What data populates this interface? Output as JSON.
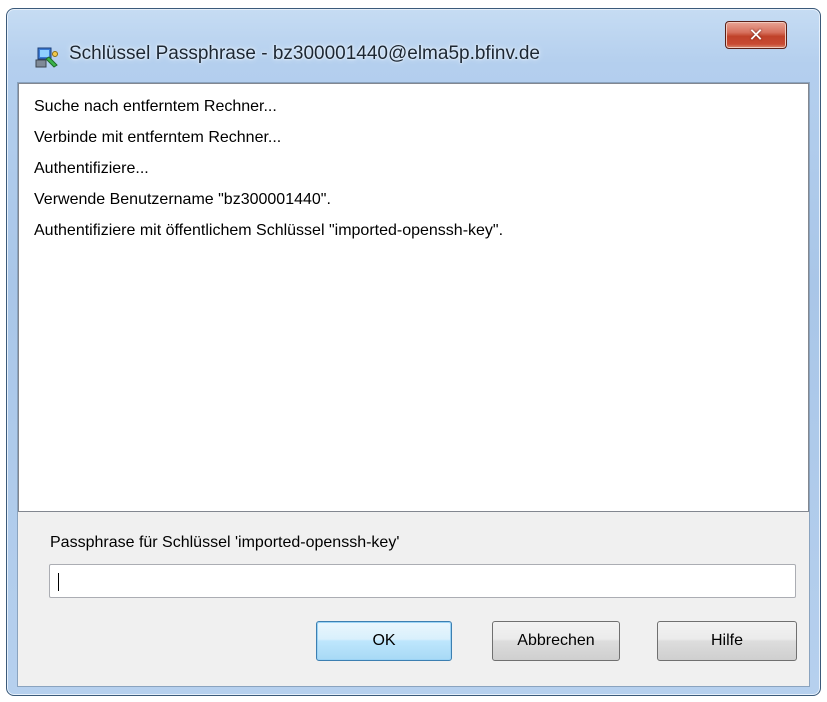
{
  "window": {
    "title": "Schlüssel Passphrase - bz300001440@elma5p.bfinv.de",
    "close_glyph": "✕",
    "icon": "putty-key-icon"
  },
  "log": {
    "lines": [
      "Suche nach entferntem Rechner...",
      "Verbinde mit entferntem Rechner...",
      "Authentifiziere...",
      "Verwende Benutzername \"bz300001440\".",
      "Authentifiziere mit öffentlichem Schlüssel \"imported-openssh-key\"."
    ]
  },
  "passphrase": {
    "label": "Passphrase für Schlüssel 'imported-openssh-key'",
    "value": ""
  },
  "buttons": {
    "ok": "OK",
    "cancel": "Abbrechen",
    "help": "Hilfe"
  },
  "colors": {
    "close_button": "#c8452d",
    "default_button_border": "#3c7fb1",
    "frame": "#b4cfee"
  }
}
